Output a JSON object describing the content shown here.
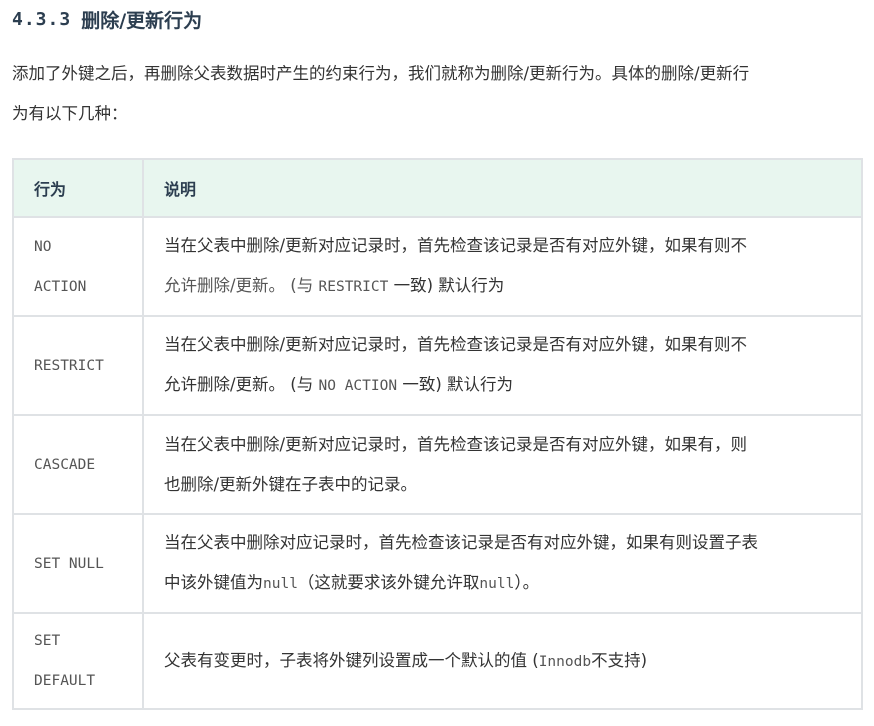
{
  "section": {
    "number": "4.3.3",
    "title": "删除/更新行为"
  },
  "intro": {
    "line1": "添加了外键之后，再删除父表数据时产生的约束行为，我们就称为删除/更新行为。具体的删除/更新行",
    "line2": "为有以下几种："
  },
  "table": {
    "headers": [
      "行为",
      "说明"
    ],
    "rows": [
      {
        "action_line1": "NO",
        "action_line2": "ACTION",
        "desc_line1": "当在父表中删除/更新对应记录时，首先检查该记录是否有对应外键，如果有则不",
        "desc_line2_a": "允许删除/更新。 (与 ",
        "desc_line2_code": "RESTRICT",
        "desc_line2_b": " 一致) 默认行为"
      },
      {
        "action_line1": "RESTRICT",
        "desc_line1": "当在父表中删除/更新对应记录时，首先检查该记录是否有对应外键，如果有则不",
        "desc_line2_a": "允许删除/更新。 (与 ",
        "desc_line2_code": "NO ACTION",
        "desc_line2_b": " 一致) 默认行为"
      },
      {
        "action_line1": "CASCADE",
        "desc_line1": "当在父表中删除/更新对应记录时，首先检查该记录是否有对应外键，如果有，则",
        "desc_line2": "也删除/更新外键在子表中的记录。"
      },
      {
        "action_line1": "SET NULL",
        "desc_line1": "当在父表中删除对应记录时，首先检查该记录是否有对应外键，如果有则设置子表",
        "desc_line2_a": "中该外键值为",
        "desc_line2_code1": "null",
        "desc_line2_b": "（这就要求该外键允许取",
        "desc_line2_code2": "null",
        "desc_line2_c": "）。"
      },
      {
        "action_line1": "SET",
        "action_line2": "DEFAULT",
        "desc_a": "父表有变更时，子表将外键列设置成一个默认的值 (",
        "desc_code": "Innodb",
        "desc_b": "不支持)"
      }
    ]
  }
}
